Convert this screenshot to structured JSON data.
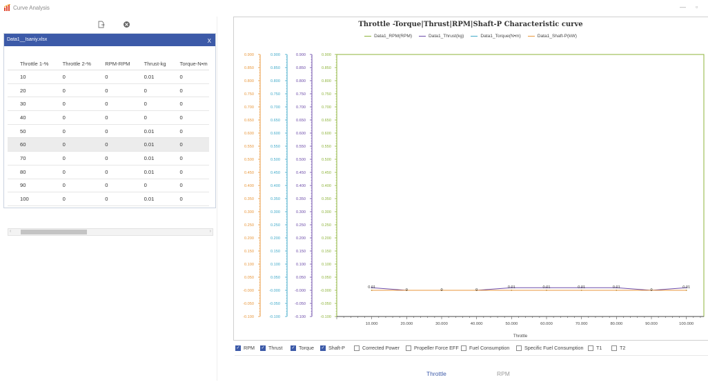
{
  "app": {
    "title": "Curve Analysis"
  },
  "window_controls": {
    "minimize": "—",
    "restore": "▫"
  },
  "data_panel": {
    "file_name": "Data1__Isaniy.xlsx",
    "close_label": "X",
    "columns": [
      "Throttle 1-%",
      "Throttle 2-%",
      "RPM-RPM",
      "Thrust-kg",
      "Torque-N•m"
    ],
    "rows": [
      [
        "10",
        "0",
        "0",
        "0.01",
        "0"
      ],
      [
        "20",
        "0",
        "0",
        "0",
        "0"
      ],
      [
        "30",
        "0",
        "0",
        "0",
        "0"
      ],
      [
        "40",
        "0",
        "0",
        "0",
        "0"
      ],
      [
        "50",
        "0",
        "0",
        "0.01",
        "0"
      ],
      [
        "60",
        "0",
        "0",
        "0.01",
        "0"
      ],
      [
        "70",
        "0",
        "0",
        "0.01",
        "0"
      ],
      [
        "80",
        "0",
        "0",
        "0.01",
        "0"
      ],
      [
        "90",
        "0",
        "0",
        "0",
        "0"
      ],
      [
        "100",
        "0",
        "0",
        "0.01",
        "0"
      ]
    ],
    "selected_row": 5
  },
  "chart_data": {
    "type": "line",
    "title": "Throttle -Torque|Thrust|RPM|Shaft-P Characteristic curve",
    "xlabel": "Throttle",
    "x": [
      10,
      20,
      30,
      40,
      50,
      60,
      70,
      80,
      90,
      100
    ],
    "xlim": [
      0,
      105
    ],
    "x_ticks": [
      "10.000",
      "20.000",
      "30.000",
      "40.000",
      "50.000",
      "60.000",
      "70.000",
      "80.000",
      "90.000",
      "100.000"
    ],
    "y_ticks": [
      "0.900",
      "0.850",
      "0.800",
      "0.750",
      "0.700",
      "0.650",
      "0.600",
      "0.550",
      "0.500",
      "0.450",
      "0.400",
      "0.350",
      "0.300",
      "0.250",
      "0.200",
      "0.150",
      "0.100",
      "0.050",
      "-0.000",
      "-0.050",
      "-0.100"
    ],
    "ylim": [
      -0.1,
      0.9
    ],
    "legend_position": "top",
    "series": [
      {
        "name": "Data1_RPM(RPM)",
        "color": "#8db33a",
        "values": [
          0,
          0,
          0,
          0,
          0,
          0,
          0,
          0,
          0,
          0
        ]
      },
      {
        "name": "Data1_Thrust(kg)",
        "color": "#6b4aa8",
        "values": [
          0.01,
          0,
          0,
          0,
          0.01,
          0.01,
          0.01,
          0.01,
          0,
          0.01
        ]
      },
      {
        "name": "Data1_Torque(N•m)",
        "color": "#3fa9c9",
        "values": [
          0,
          0,
          0,
          0,
          0,
          0,
          0,
          0,
          0,
          0
        ]
      },
      {
        "name": "Data1_Shaft-P(kW)",
        "color": "#e8963a",
        "values": [
          0,
          0,
          0,
          0,
          0,
          0,
          0,
          0,
          0,
          0
        ]
      }
    ],
    "data_labels": [
      "0.01",
      "0",
      "0",
      "0",
      "0.01",
      "0.01",
      "0.01",
      "0.01",
      "0",
      "0.01"
    ],
    "axis_colors": [
      "#e8963a",
      "#3fa9c9",
      "#6b4aa8",
      "#8db33a"
    ]
  },
  "checkboxes": [
    {
      "label": "RPM",
      "checked": true
    },
    {
      "label": "Thrust",
      "checked": true
    },
    {
      "label": "Torque",
      "checked": true
    },
    {
      "label": "Shaft-P",
      "checked": true
    },
    {
      "label": "Corrected Power",
      "checked": false
    },
    {
      "label": "Propeller Force EFF",
      "checked": false
    },
    {
      "label": "Fuel Consumption",
      "checked": false
    },
    {
      "label": "Specific Fuel Consumption",
      "checked": false
    },
    {
      "label": "T1",
      "checked": false
    },
    {
      "label": "T2",
      "checked": false
    }
  ],
  "bottom_tabs": [
    {
      "label": "Throttle",
      "active": true,
      "color": "#3c5aa8"
    },
    {
      "label": "RPM",
      "active": false,
      "color": "#9a9a9a"
    }
  ]
}
